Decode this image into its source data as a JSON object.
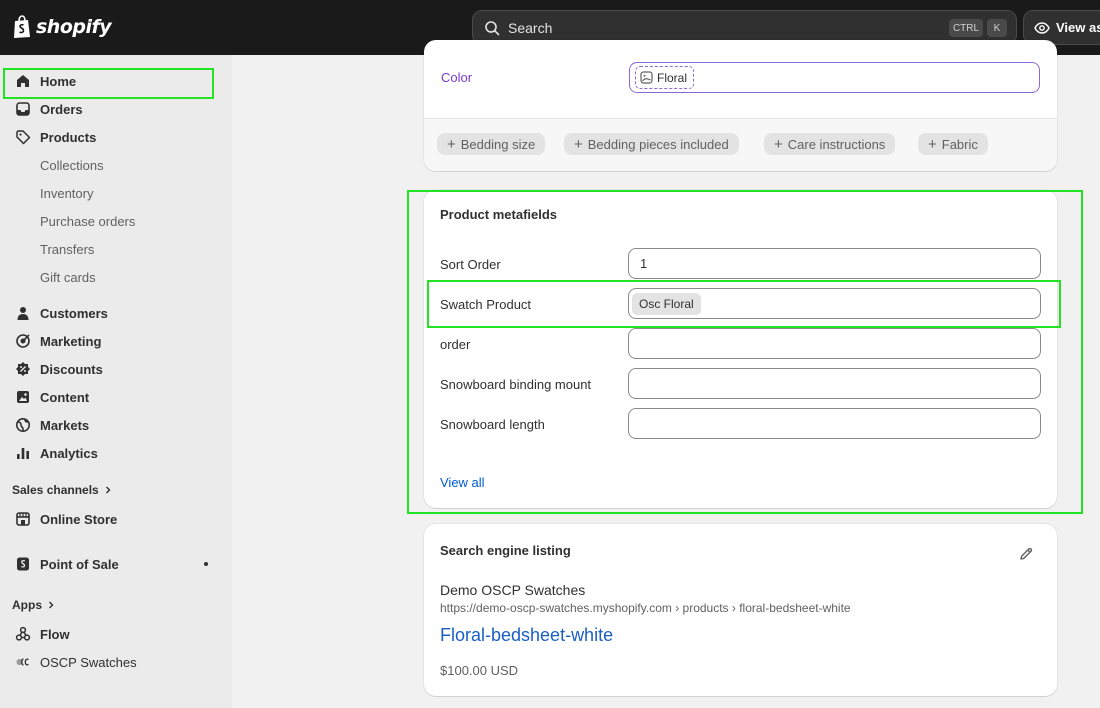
{
  "topbar": {
    "logo_text": "shopify",
    "search_placeholder": "Search",
    "shortcut_ctrl": "CTRL",
    "shortcut_key": "K",
    "view_as_label": "View as"
  },
  "sidebar": {
    "items": [
      {
        "label": "Home",
        "icon": "home-icon"
      },
      {
        "label": "Orders",
        "icon": "inbox-icon"
      },
      {
        "label": "Products",
        "icon": "tag-icon"
      },
      {
        "label": "Customers",
        "icon": "person-icon"
      },
      {
        "label": "Marketing",
        "icon": "target-icon"
      },
      {
        "label": "Discounts",
        "icon": "discount-icon"
      },
      {
        "label": "Content",
        "icon": "content-icon"
      },
      {
        "label": "Markets",
        "icon": "globe-icon"
      },
      {
        "label": "Analytics",
        "icon": "bar-chart-icon"
      }
    ],
    "product_subitems": [
      "Collections",
      "Inventory",
      "Purchase orders",
      "Transfers",
      "Gift cards"
    ],
    "sales_channels_header": "Sales channels",
    "sales_channels": [
      {
        "label": "Online Store",
        "icon": "store-icon"
      },
      {
        "label": "Point of Sale",
        "icon": "pos-icon"
      }
    ],
    "apps_header": "Apps",
    "apps": [
      {
        "label": "Flow",
        "icon": "flow-icon"
      },
      {
        "label": "OSCP Swatches",
        "icon": "oscp-icon"
      }
    ]
  },
  "variant_options": {
    "color_label": "Color",
    "color_value": "Floral",
    "add_options": [
      "Bedding size",
      "Bedding pieces included",
      "Care instructions",
      "Fabric"
    ]
  },
  "metafields": {
    "title": "Product metafields",
    "rows": [
      {
        "label": "Sort Order",
        "value": "1"
      },
      {
        "label": "Swatch Product",
        "value": "Osc Floral"
      },
      {
        "label": "order",
        "value": ""
      },
      {
        "label": "Snowboard binding mount",
        "value": ""
      },
      {
        "label": "Snowboard length",
        "value": ""
      }
    ],
    "view_all": "View all"
  },
  "seo": {
    "title": "Search engine listing",
    "site_name": "Demo OSCP Swatches",
    "url": "https://demo-oscp-swatches.myshopify.com › products › floral-bedsheet-white",
    "page_title": "Floral-bedsheet-white",
    "price": "$100.00 USD"
  }
}
